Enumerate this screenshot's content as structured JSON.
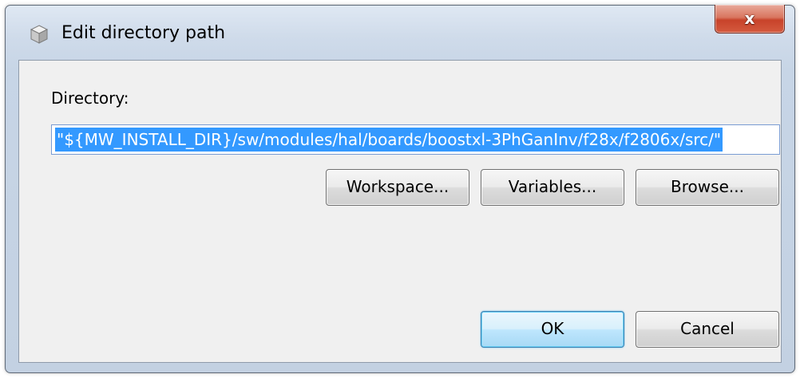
{
  "window": {
    "title": "Edit directory path",
    "close_glyph": "x"
  },
  "form": {
    "directory_label": "Directory:",
    "directory_value": "\"${MW_INSTALL_DIR}/sw/modules/hal/boards/boostxl-3PhGanInv/f28x/f2806x/src/\""
  },
  "buttons": {
    "workspace": "Workspace...",
    "variables": "Variables...",
    "browse": "Browse...",
    "ok": "OK",
    "cancel": "Cancel"
  },
  "icons": {
    "title": "dialog-cube-icon",
    "close": "close-icon"
  },
  "colors": {
    "selection": "#3399ff",
    "close_button": "#c8432a",
    "ok_border": "#3c7fb1"
  }
}
